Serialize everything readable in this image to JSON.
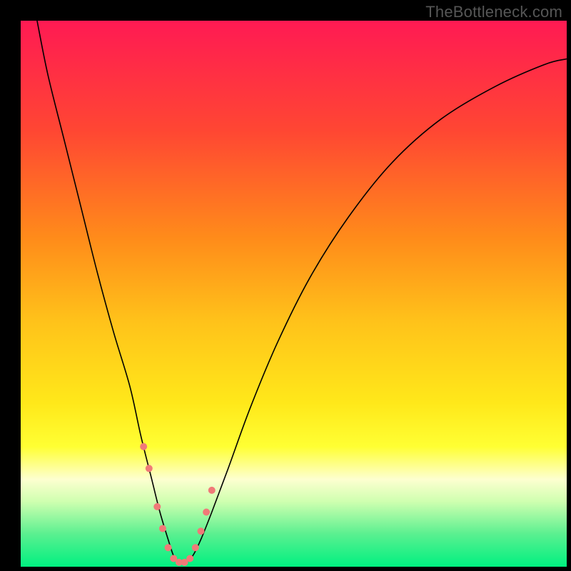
{
  "watermark": "TheBottleneck.com",
  "chart_data": {
    "type": "line",
    "title": "",
    "xlabel": "",
    "ylabel": "",
    "xlim": [
      0,
      100
    ],
    "ylim": [
      0,
      100
    ],
    "background_gradient": {
      "type": "vertical",
      "stops": [
        {
          "pos": 0.0,
          "color": "#ff1a53"
        },
        {
          "pos": 0.2,
          "color": "#ff4633"
        },
        {
          "pos": 0.4,
          "color": "#ff8c1a"
        },
        {
          "pos": 0.55,
          "color": "#ffc21a"
        },
        {
          "pos": 0.7,
          "color": "#ffe81a"
        },
        {
          "pos": 0.78,
          "color": "#ffff33"
        },
        {
          "pos": 0.84,
          "color": "#fdffd0"
        },
        {
          "pos": 0.88,
          "color": "#d0ffb0"
        },
        {
          "pos": 0.94,
          "color": "#5bf090"
        },
        {
          "pos": 1.0,
          "color": "#00f080"
        }
      ]
    },
    "series": [
      {
        "name": "bottleneck-curve",
        "color": "#000000",
        "stroke_width": 1.6,
        "x": [
          3,
          5,
          8,
          11,
          14,
          17,
          20,
          22,
          24,
          25.5,
          27,
          28,
          29,
          30,
          31.5,
          33,
          35,
          38,
          42,
          47,
          53,
          60,
          68,
          77,
          87,
          96,
          100
        ],
        "y": [
          100,
          90,
          78,
          66,
          54,
          43,
          33,
          24,
          16,
          10,
          5,
          2,
          0.7,
          0.7,
          2,
          5,
          10,
          18,
          29,
          41,
          53,
          64,
          74,
          82,
          88,
          92,
          93
        ]
      }
    ],
    "markers": {
      "name": "low-bottleneck-markers",
      "color": "#f07a78",
      "radius": 5,
      "points": [
        {
          "x": 22.5,
          "y": 22
        },
        {
          "x": 23.5,
          "y": 18
        },
        {
          "x": 25.0,
          "y": 11
        },
        {
          "x": 26.0,
          "y": 7
        },
        {
          "x": 27.0,
          "y": 3.5
        },
        {
          "x": 28.0,
          "y": 1.5
        },
        {
          "x": 29.0,
          "y": 0.8
        },
        {
          "x": 30.0,
          "y": 0.8
        },
        {
          "x": 31.0,
          "y": 1.5
        },
        {
          "x": 32.0,
          "y": 3.5
        },
        {
          "x": 33.0,
          "y": 6.5
        },
        {
          "x": 34.0,
          "y": 10
        },
        {
          "x": 35.0,
          "y": 14
        }
      ]
    }
  }
}
